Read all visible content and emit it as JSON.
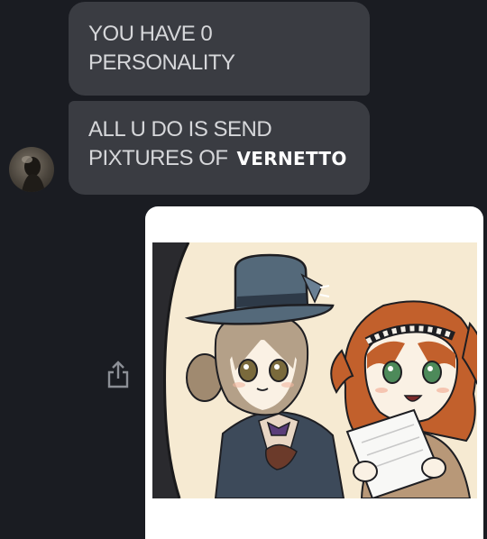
{
  "messages": [
    {
      "line1": "YOU HAVE 0",
      "line2": "PERSONALITY"
    },
    {
      "line1": "ALL U DO IS SEND",
      "line2": "PIXTURES OF",
      "overlay": "VERNETTO"
    }
  ],
  "sender": {
    "avatar": "avatar"
  },
  "attachment": {
    "icon": "share-icon"
  },
  "colors": {
    "background": "#1a1c22",
    "bubble": "#3a3c42",
    "bubble_text": "#d6d7da",
    "image_card": "#ffffff"
  }
}
